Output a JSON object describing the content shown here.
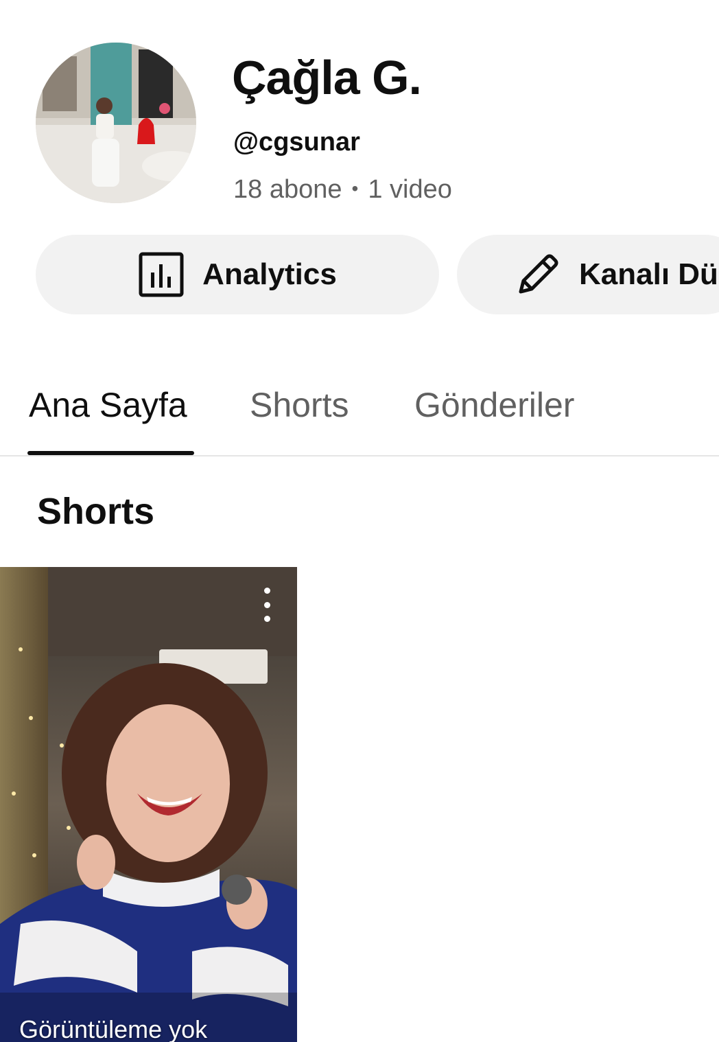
{
  "channel": {
    "name": "Çağla G.",
    "handle": "@cgsunar",
    "subscribers": "18 abone",
    "separator": "•",
    "videos": "1 video"
  },
  "actions": {
    "analytics_label": "Analytics",
    "edit_label": "Kanalı Dü"
  },
  "tabs": [
    {
      "label": "Ana Sayfa",
      "active": true
    },
    {
      "label": "Shorts",
      "active": false
    },
    {
      "label": "Gönderiler",
      "active": false
    }
  ],
  "section": {
    "title": "Shorts"
  },
  "short": {
    "views": "Görüntüleme yok"
  },
  "icons": {
    "analytics": "bar-chart-icon",
    "edit": "pencil-icon",
    "more": "more-vertical-icon"
  }
}
